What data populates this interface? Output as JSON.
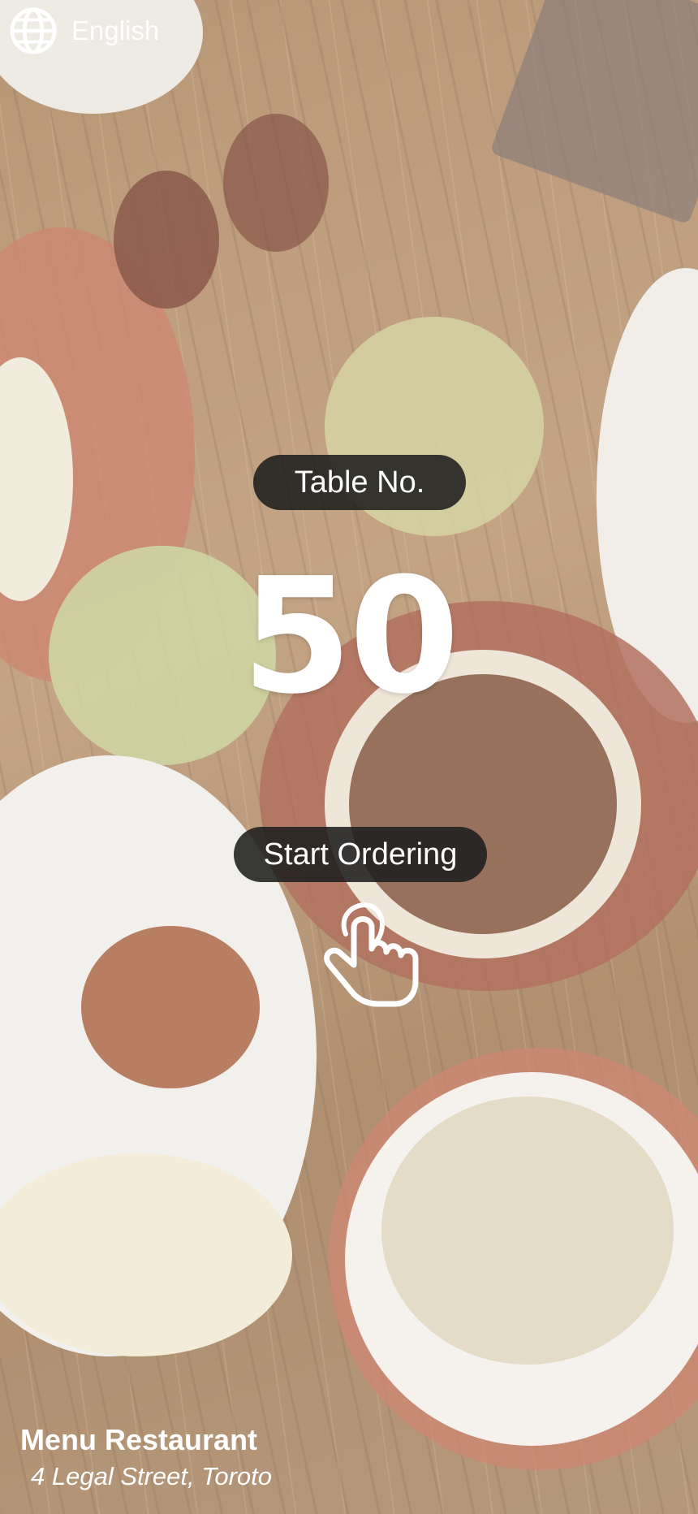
{
  "language": {
    "label": "English",
    "icon": "globe-icon"
  },
  "table": {
    "label": "Table No.",
    "number": "50"
  },
  "start": {
    "label": "Start Ordering",
    "icon": "tap-hand-icon"
  },
  "restaurant": {
    "name": "Menu Restaurant",
    "address": "4 Legal Street, Toroto"
  },
  "colors": {
    "pill_bg": "#1e1e1e",
    "text": "#ffffff",
    "table_wood": "#a47a50"
  }
}
